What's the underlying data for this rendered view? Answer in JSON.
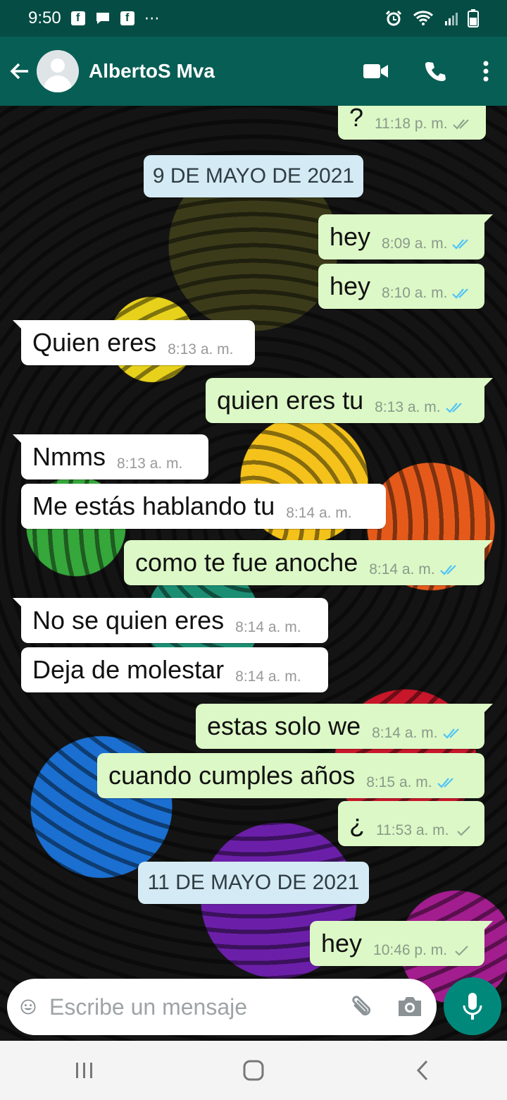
{
  "status_bar": {
    "time": "9:50",
    "overflow": "⋯"
  },
  "header": {
    "contact_name": "AlbertoS Mva"
  },
  "chat": {
    "date_chips": [
      "9 DE MAYO DE 2021",
      "11 DE MAYO DE 2021"
    ],
    "messages": [
      {
        "text": "?",
        "time": "11:18 p. m.",
        "direction": "out",
        "status": "delivered"
      },
      {
        "text": "hey",
        "time": "8:09 a. m.",
        "direction": "out",
        "status": "read"
      },
      {
        "text": "hey",
        "time": "8:10 a. m.",
        "direction": "out",
        "status": "read"
      },
      {
        "text": "Quien eres",
        "time": "8:13 a. m.",
        "direction": "in"
      },
      {
        "text": "quien eres tu",
        "time": "8:13 a. m.",
        "direction": "out",
        "status": "read"
      },
      {
        "text": "Nmms",
        "time": "8:13 a. m.",
        "direction": "in"
      },
      {
        "text": "Me estás hablando tu",
        "time": "8:14 a. m.",
        "direction": "in"
      },
      {
        "text": "como te fue anoche",
        "time": "8:14 a. m.",
        "direction": "out",
        "status": "read"
      },
      {
        "text": "No se quien eres",
        "time": "8:14 a. m.",
        "direction": "in"
      },
      {
        "text": "Deja de molestar",
        "time": "8:14 a. m.",
        "direction": "in"
      },
      {
        "text": "estas solo we",
        "time": "8:14 a. m.",
        "direction": "out",
        "status": "read"
      },
      {
        "text": "cuando cumples años",
        "time": "8:15 a. m.",
        "direction": "out",
        "status": "read"
      },
      {
        "text": "¿",
        "time": "11:53 a. m.",
        "direction": "out",
        "status": "sent"
      },
      {
        "text": "hey",
        "time": "10:46 p. m.",
        "direction": "out",
        "status": "sent"
      }
    ]
  },
  "input": {
    "placeholder": "Escribe un mensaje"
  },
  "icons": {
    "back": "arrow-left-icon",
    "video": "video-camera-icon",
    "call": "phone-icon",
    "menu": "more-vert-icon",
    "emoji": "emoji-icon",
    "attach": "paperclip-icon",
    "camera": "camera-icon",
    "mic": "microphone-icon"
  },
  "colors": {
    "header": "#075e54",
    "status_bar": "#054d44",
    "outgoing_bubble": "#dcf8c6",
    "incoming_bubble": "#ffffff",
    "date_chip": "#d4eaf4",
    "mic_button": "#00897b",
    "read_tick": "#4fc3f7",
    "sent_tick": "#8fa58f"
  }
}
